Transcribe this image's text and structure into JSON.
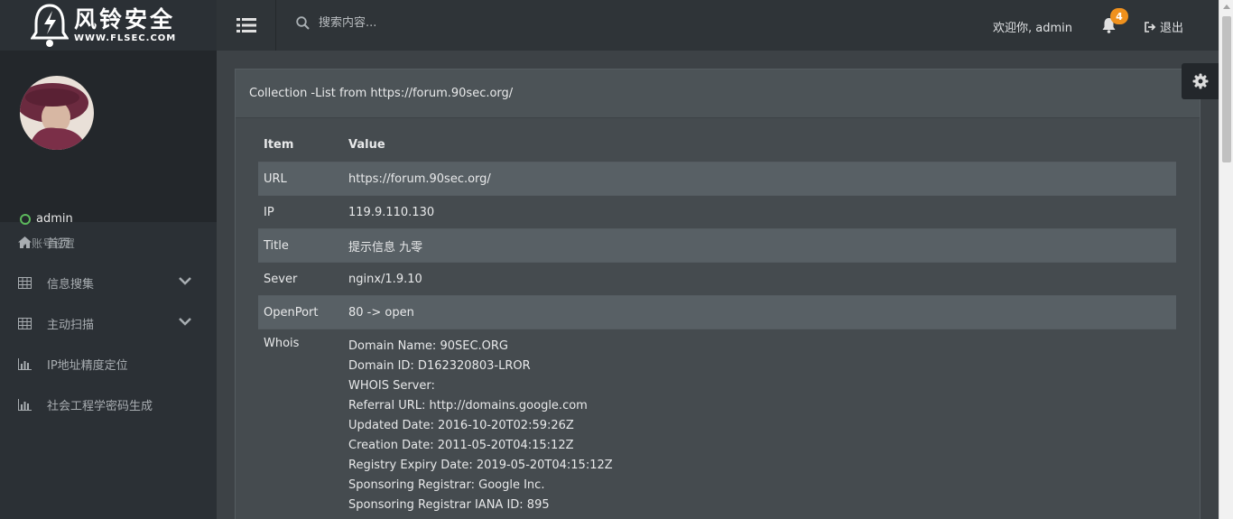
{
  "brand": {
    "name_cn": "风铃安全",
    "domain": "WWW.FLSEC.COM"
  },
  "topbar": {
    "search_placeholder": "搜索内容...",
    "welcome": "欢迎你, admin",
    "notification_count": "4",
    "logout_label": "退出"
  },
  "user": {
    "name": "admin",
    "settings_label": "账号设置",
    "status_color": "#5cb85c"
  },
  "nav": [
    {
      "label": "首页",
      "icon": "home-icon"
    },
    {
      "label": "信息搜集",
      "icon": "table-icon",
      "expandable": true
    },
    {
      "label": "主动扫描",
      "icon": "table-icon",
      "expandable": true
    },
    {
      "label": "IP地址精度定位",
      "icon": "bar-chart-icon"
    },
    {
      "label": "社会工程学密码生成",
      "icon": "bar-chart-icon"
    }
  ],
  "panel": {
    "title": "Collection -List from https://forum.90sec.org/",
    "headers": {
      "item": "Item",
      "value": "Value"
    },
    "rows": [
      {
        "item": "URL",
        "value": "https://forum.90sec.org/"
      },
      {
        "item": "IP",
        "value": "119.9.110.130"
      },
      {
        "item": "Title",
        "value": "提示信息 九零"
      },
      {
        "item": "Sever",
        "value": "nginx/1.9.10"
      },
      {
        "item": "OpenPort",
        "value": "80 -> open"
      }
    ],
    "whois": {
      "item": "Whois",
      "lines": [
        "Domain Name: 90SEC.ORG",
        "Domain ID: D162320803-LROR",
        "WHOIS Server:",
        "Referral URL: http://domains.google.com",
        "Updated Date: 2016-10-20T02:59:26Z",
        "Creation Date: 2011-05-20T04:15:12Z",
        "Registry Expiry Date: 2019-05-20T04:15:12Z",
        "Sponsoring Registrar: Google Inc.",
        "Sponsoring Registrar IANA ID: 895"
      ]
    }
  },
  "colors": {
    "accent_badge": "#f0911d",
    "sidebar_bg": "#2b3035",
    "content_bg": "#3d4246"
  }
}
